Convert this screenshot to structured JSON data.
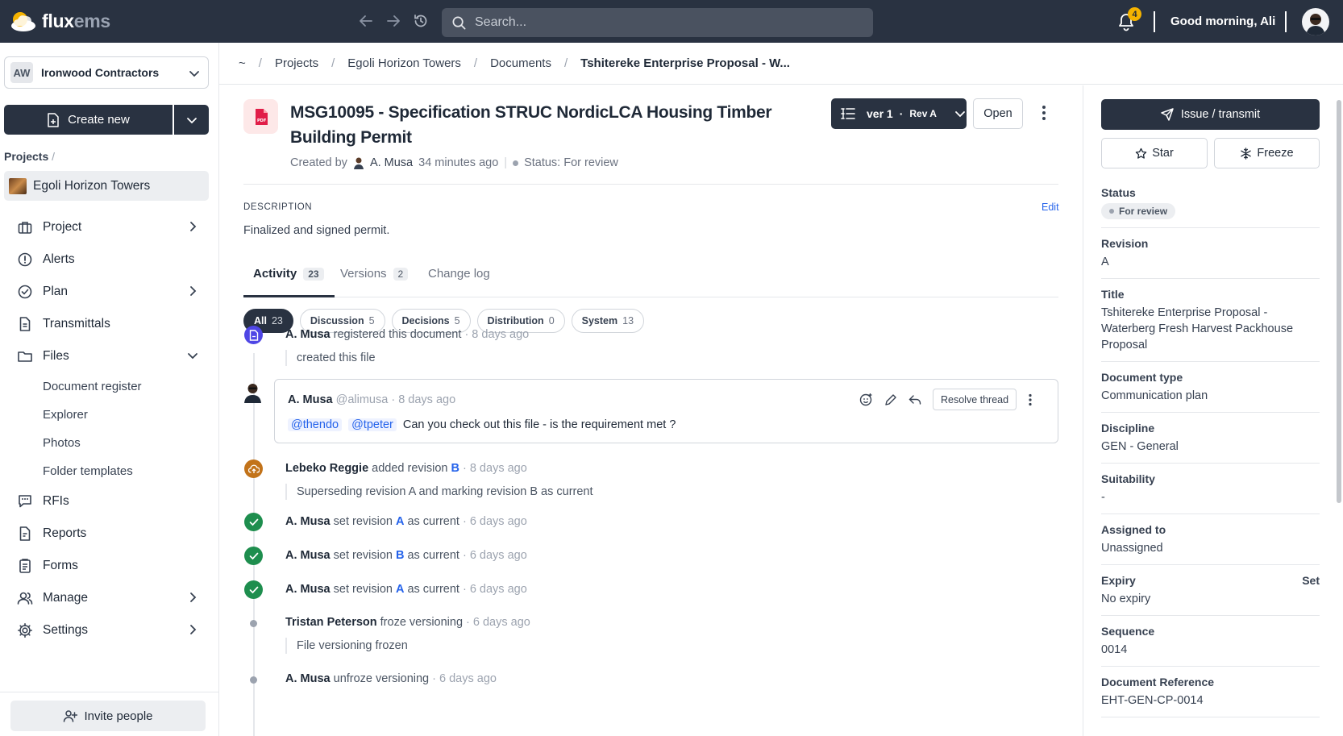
{
  "topbar": {
    "brand_main": "flux",
    "brand_accent": "ems",
    "search_placeholder": "Search...",
    "notification_count": "4",
    "greeting": "Good morning, Ali"
  },
  "sidebar": {
    "org_initials": "AW",
    "org_name": "Ironwood Contractors",
    "create_label": "Create new",
    "projects_label": "Projects",
    "current_project": "Egoli Horizon Towers",
    "nav": [
      {
        "label": "Project"
      },
      {
        "label": "Alerts"
      },
      {
        "label": "Plan"
      },
      {
        "label": "Transmittals"
      },
      {
        "label": "Files"
      }
    ],
    "files_sub": [
      "Document register",
      "Explorer",
      "Photos",
      "Folder templates"
    ],
    "nav2": [
      {
        "label": "RFIs"
      },
      {
        "label": "Reports"
      },
      {
        "label": "Forms"
      },
      {
        "label": "Manage"
      },
      {
        "label": "Settings"
      }
    ],
    "invite_label": "Invite people"
  },
  "breadcrumb": {
    "home": "~",
    "items": [
      "Projects",
      "Egoli Horizon Towers",
      "Documents",
      "Tshitereke Enterprise Proposal - W..."
    ]
  },
  "document": {
    "title": "MSG10095 - Specification STRUC NordicLCA Housing Timber Building Permit",
    "created_by_label": "Created by",
    "author": "A. Musa",
    "created_ago": "34 minutes ago",
    "status_text": "Status: For review",
    "version_label": "ver 1",
    "rev_label": "Rev A",
    "open_label": "Open",
    "description_label": "DESCRIPTION",
    "edit_label": "Edit",
    "description": "Finalized and signed permit."
  },
  "tabs": [
    {
      "label": "Activity",
      "count": "23"
    },
    {
      "label": "Versions",
      "count": "2"
    },
    {
      "label": "Change log",
      "count": ""
    }
  ],
  "filters": [
    {
      "label": "All",
      "count": "23"
    },
    {
      "label": "Discussion",
      "count": "5"
    },
    {
      "label": "Decisions",
      "count": "5"
    },
    {
      "label": "Distribution",
      "count": "0"
    },
    {
      "label": "System",
      "count": "13"
    }
  ],
  "activity": {
    "e1": {
      "user": "A. Musa",
      "action": "registered this document",
      "ago": "· 8 days ago",
      "note": "created this file"
    },
    "comment": {
      "user": "A. Musa",
      "handle": "@alimusa",
      "ago": "· 8 days ago",
      "mention1": "@thendo",
      "mention2": "@tpeter",
      "text": "Can you check out this file -  is the requirement met ?",
      "resolve_label": "Resolve thread"
    },
    "e2": {
      "user": "Lebeko Reggie",
      "action": "added revision",
      "rev": "B",
      "ago": "· 8 days ago",
      "note": "Superseding revision A and marking revision B as current"
    },
    "e3": {
      "user": "A. Musa",
      "action": "set revision",
      "rev": "A",
      "suffix": "as current",
      "ago": "· 6 days ago"
    },
    "e4": {
      "user": "A. Musa",
      "action": "set revision",
      "rev": "B",
      "suffix": "as current",
      "ago": "· 6 days ago"
    },
    "e5": {
      "user": "A. Musa",
      "action": "set revision",
      "rev": "A",
      "suffix": "as current",
      "ago": "· 6 days ago"
    },
    "e6": {
      "user": "Tristan Peterson",
      "action": "froze versioning",
      "ago": "· 6 days ago",
      "note": "File versioning frozen"
    },
    "e7": {
      "user": "A. Musa",
      "action": "unfroze versioning",
      "ago": "· 6 days ago"
    }
  },
  "panel": {
    "issue_label": "Issue / transmit",
    "star_label": "Star",
    "freeze_label": "Freeze",
    "status_label": "Status",
    "status_value": "For review",
    "revision_label": "Revision",
    "revision_value": "A",
    "title_label": "Title",
    "title_value": "Tshitereke Enterprise Proposal - Waterberg Fresh Harvest Packhouse Proposal",
    "doctype_label": "Document type",
    "doctype_value": "Communication plan",
    "discipline_label": "Discipline",
    "discipline_value": "GEN - General",
    "suitability_label": "Suitability",
    "suitability_value": "-",
    "assigned_label": "Assigned to",
    "assigned_value": "Unassigned",
    "expiry_label": "Expiry",
    "expiry_set": "Set",
    "expiry_value": "No expiry",
    "sequence_label": "Sequence",
    "sequence_value": "0014",
    "docref_label": "Document Reference",
    "docref_value": "EHT-GEN-CP-0014"
  },
  "colors": {
    "topbar_bg": "#293241",
    "primary_btn": "#293241",
    "link": "#2563eb",
    "success": "#1e8e4e",
    "upload": "#c2731a",
    "doc_icon": "#4f46e5",
    "pdf": "#e11d48",
    "badge": "#f5b300"
  }
}
